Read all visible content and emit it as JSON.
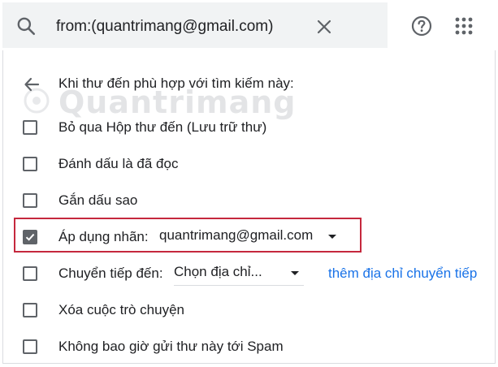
{
  "search": {
    "query": "from:(quantrimang@gmail.com)",
    "icon": "search-icon",
    "clear_icon": "close-icon"
  },
  "toolbar": {
    "help_icon": "help-icon",
    "apps_icon": "apps-grid-icon"
  },
  "filter": {
    "heading": "Khi thư đến phù hợp với tìm kiếm này:",
    "watermark": "Quantrimang",
    "options": [
      {
        "label": "Bỏ qua Hộp thư đến (Lưu trữ thư)",
        "checked": false
      },
      {
        "label": "Đánh dấu là đã đọc",
        "checked": false
      },
      {
        "label": "Gắn dấu sao",
        "checked": false
      },
      {
        "label": "Áp dụng nhãn:",
        "checked": true,
        "select_value": "quantrimang@gmail.com"
      },
      {
        "label": "Chuyển tiếp đến:",
        "checked": false,
        "select_value": "Chọn địa chỉ...",
        "link": "thêm địa chỉ chuyển tiếp"
      },
      {
        "label": "Xóa cuộc trò chuyện",
        "checked": false
      },
      {
        "label": "Không bao giờ gửi thư này tới Spam",
        "checked": false
      }
    ]
  },
  "colors": {
    "highlight_border": "#c5283d",
    "link": "#1a73e8",
    "search_bg": "#f1f3f4"
  }
}
